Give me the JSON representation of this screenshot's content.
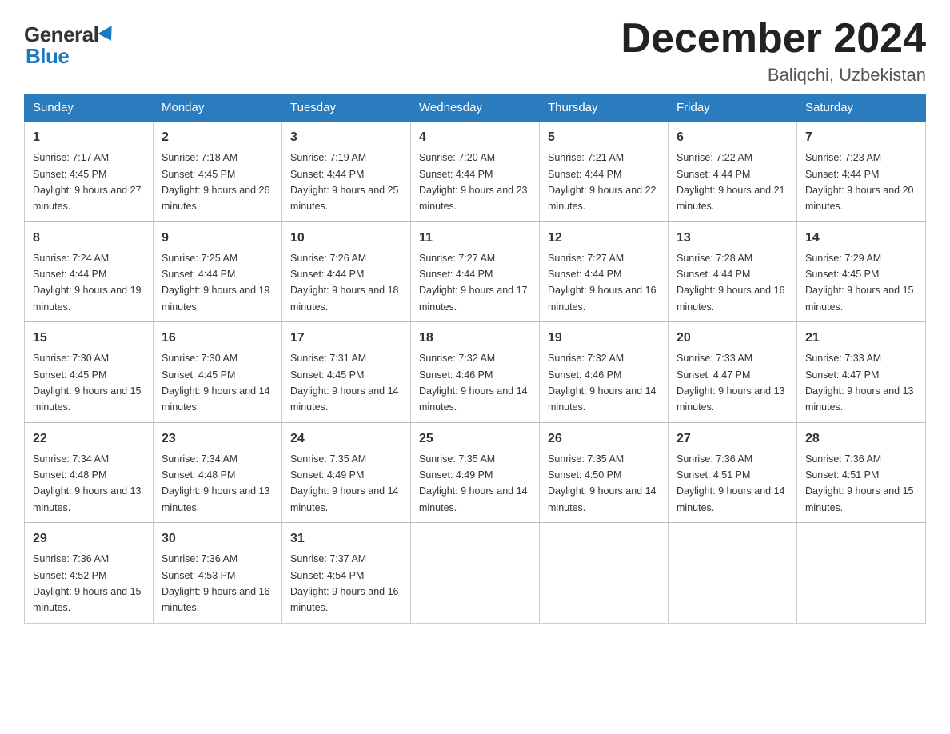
{
  "logo": {
    "general": "General",
    "blue": "Blue"
  },
  "title": "December 2024",
  "location": "Baliqchi, Uzbekistan",
  "weekdays": [
    "Sunday",
    "Monday",
    "Tuesday",
    "Wednesday",
    "Thursday",
    "Friday",
    "Saturday"
  ],
  "weeks": [
    [
      {
        "day": "1",
        "sunrise": "7:17 AM",
        "sunset": "4:45 PM",
        "daylight": "9 hours and 27 minutes."
      },
      {
        "day": "2",
        "sunrise": "7:18 AM",
        "sunset": "4:45 PM",
        "daylight": "9 hours and 26 minutes."
      },
      {
        "day": "3",
        "sunrise": "7:19 AM",
        "sunset": "4:44 PM",
        "daylight": "9 hours and 25 minutes."
      },
      {
        "day": "4",
        "sunrise": "7:20 AM",
        "sunset": "4:44 PM",
        "daylight": "9 hours and 23 minutes."
      },
      {
        "day": "5",
        "sunrise": "7:21 AM",
        "sunset": "4:44 PM",
        "daylight": "9 hours and 22 minutes."
      },
      {
        "day": "6",
        "sunrise": "7:22 AM",
        "sunset": "4:44 PM",
        "daylight": "9 hours and 21 minutes."
      },
      {
        "day": "7",
        "sunrise": "7:23 AM",
        "sunset": "4:44 PM",
        "daylight": "9 hours and 20 minutes."
      }
    ],
    [
      {
        "day": "8",
        "sunrise": "7:24 AM",
        "sunset": "4:44 PM",
        "daylight": "9 hours and 19 minutes."
      },
      {
        "day": "9",
        "sunrise": "7:25 AM",
        "sunset": "4:44 PM",
        "daylight": "9 hours and 19 minutes."
      },
      {
        "day": "10",
        "sunrise": "7:26 AM",
        "sunset": "4:44 PM",
        "daylight": "9 hours and 18 minutes."
      },
      {
        "day": "11",
        "sunrise": "7:27 AM",
        "sunset": "4:44 PM",
        "daylight": "9 hours and 17 minutes."
      },
      {
        "day": "12",
        "sunrise": "7:27 AM",
        "sunset": "4:44 PM",
        "daylight": "9 hours and 16 minutes."
      },
      {
        "day": "13",
        "sunrise": "7:28 AM",
        "sunset": "4:44 PM",
        "daylight": "9 hours and 16 minutes."
      },
      {
        "day": "14",
        "sunrise": "7:29 AM",
        "sunset": "4:45 PM",
        "daylight": "9 hours and 15 minutes."
      }
    ],
    [
      {
        "day": "15",
        "sunrise": "7:30 AM",
        "sunset": "4:45 PM",
        "daylight": "9 hours and 15 minutes."
      },
      {
        "day": "16",
        "sunrise": "7:30 AM",
        "sunset": "4:45 PM",
        "daylight": "9 hours and 14 minutes."
      },
      {
        "day": "17",
        "sunrise": "7:31 AM",
        "sunset": "4:45 PM",
        "daylight": "9 hours and 14 minutes."
      },
      {
        "day": "18",
        "sunrise": "7:32 AM",
        "sunset": "4:46 PM",
        "daylight": "9 hours and 14 minutes."
      },
      {
        "day": "19",
        "sunrise": "7:32 AM",
        "sunset": "4:46 PM",
        "daylight": "9 hours and 14 minutes."
      },
      {
        "day": "20",
        "sunrise": "7:33 AM",
        "sunset": "4:47 PM",
        "daylight": "9 hours and 13 minutes."
      },
      {
        "day": "21",
        "sunrise": "7:33 AM",
        "sunset": "4:47 PM",
        "daylight": "9 hours and 13 minutes."
      }
    ],
    [
      {
        "day": "22",
        "sunrise": "7:34 AM",
        "sunset": "4:48 PM",
        "daylight": "9 hours and 13 minutes."
      },
      {
        "day": "23",
        "sunrise": "7:34 AM",
        "sunset": "4:48 PM",
        "daylight": "9 hours and 13 minutes."
      },
      {
        "day": "24",
        "sunrise": "7:35 AM",
        "sunset": "4:49 PM",
        "daylight": "9 hours and 14 minutes."
      },
      {
        "day": "25",
        "sunrise": "7:35 AM",
        "sunset": "4:49 PM",
        "daylight": "9 hours and 14 minutes."
      },
      {
        "day": "26",
        "sunrise": "7:35 AM",
        "sunset": "4:50 PM",
        "daylight": "9 hours and 14 minutes."
      },
      {
        "day": "27",
        "sunrise": "7:36 AM",
        "sunset": "4:51 PM",
        "daylight": "9 hours and 14 minutes."
      },
      {
        "day": "28",
        "sunrise": "7:36 AM",
        "sunset": "4:51 PM",
        "daylight": "9 hours and 15 minutes."
      }
    ],
    [
      {
        "day": "29",
        "sunrise": "7:36 AM",
        "sunset": "4:52 PM",
        "daylight": "9 hours and 15 minutes."
      },
      {
        "day": "30",
        "sunrise": "7:36 AM",
        "sunset": "4:53 PM",
        "daylight": "9 hours and 16 minutes."
      },
      {
        "day": "31",
        "sunrise": "7:37 AM",
        "sunset": "4:54 PM",
        "daylight": "9 hours and 16 minutes."
      },
      null,
      null,
      null,
      null
    ]
  ]
}
